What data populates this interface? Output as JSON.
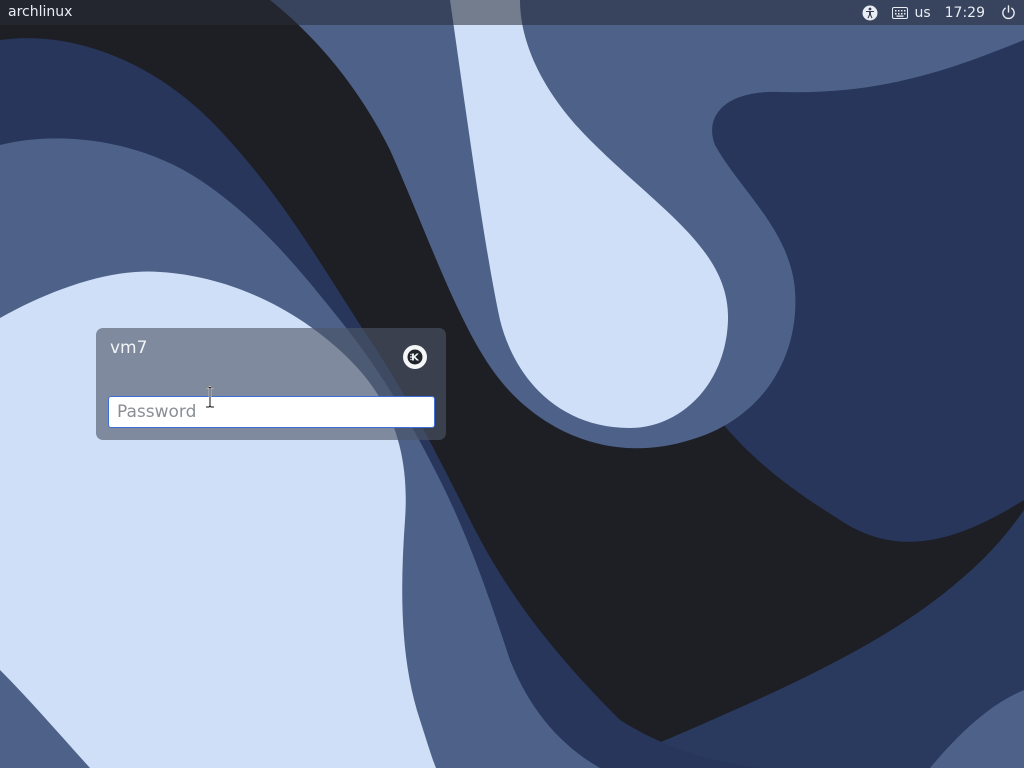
{
  "topbar": {
    "hostname": "archlinux",
    "keyboard_layout": "us",
    "clock": "17:29",
    "icons": [
      "accessibility-icon",
      "keyboard-icon",
      "power-icon"
    ]
  },
  "login": {
    "username": "vm7",
    "password_placeholder": "Password",
    "session_icon": "kde-session-icon"
  },
  "colors": {
    "wallpaper_dark": "#1d1f25",
    "wallpaper_navy": "#27365a",
    "wallpaper_mid": "#4d6189",
    "wallpaper_light": "#cfdff7",
    "field_focus": "#3d6fd6"
  }
}
